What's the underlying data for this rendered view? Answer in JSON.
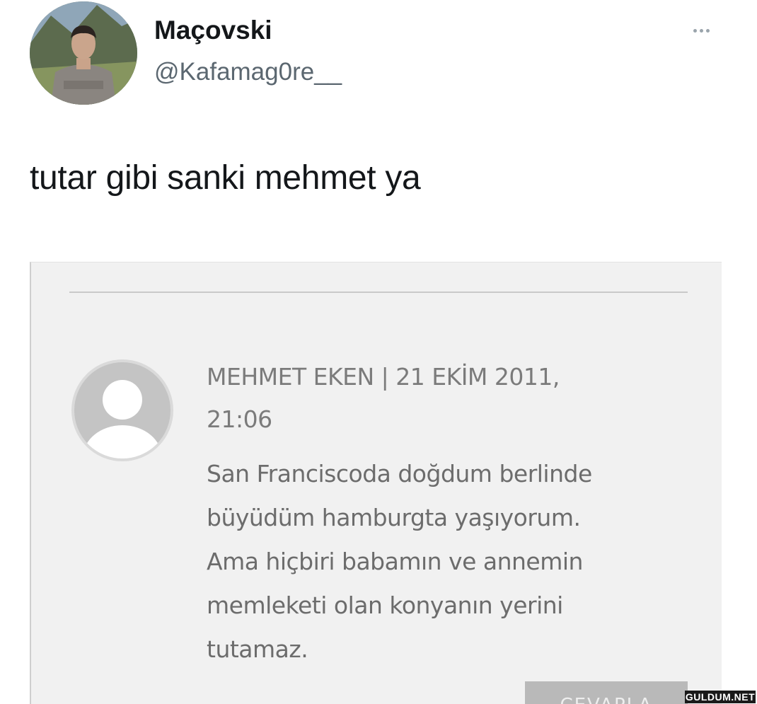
{
  "tweet": {
    "author": {
      "display_name": "Maçovski",
      "handle": "@Kafamag0re__",
      "avatar_icon": "profile-photo"
    },
    "more_icon": "ellipsis-icon",
    "text": "tutar gibi sanki mehmet ya"
  },
  "embedded_comment": {
    "avatar_icon": "default-user-icon",
    "meta_line1": "MEHMET EKEN | 21 EKİM 2011,",
    "meta_line2": "21:06",
    "body_lines": [
      "San Franciscoda doğdum berlinde",
      "büyüdüm hamburgta yaşıyorum.",
      "Ama hiçbiri babamın ve annemin",
      "memleketi olan konyanın yerini",
      "tutamaz."
    ],
    "reply_label": "CEVAPLA"
  },
  "watermark": "GULDUM.NET",
  "colors": {
    "text": "#14171a",
    "handle": "#5b6770",
    "embed_bg": "#f1f1f1",
    "comment_text": "#6c6c6c",
    "reply_bg": "#b9b9b9"
  }
}
